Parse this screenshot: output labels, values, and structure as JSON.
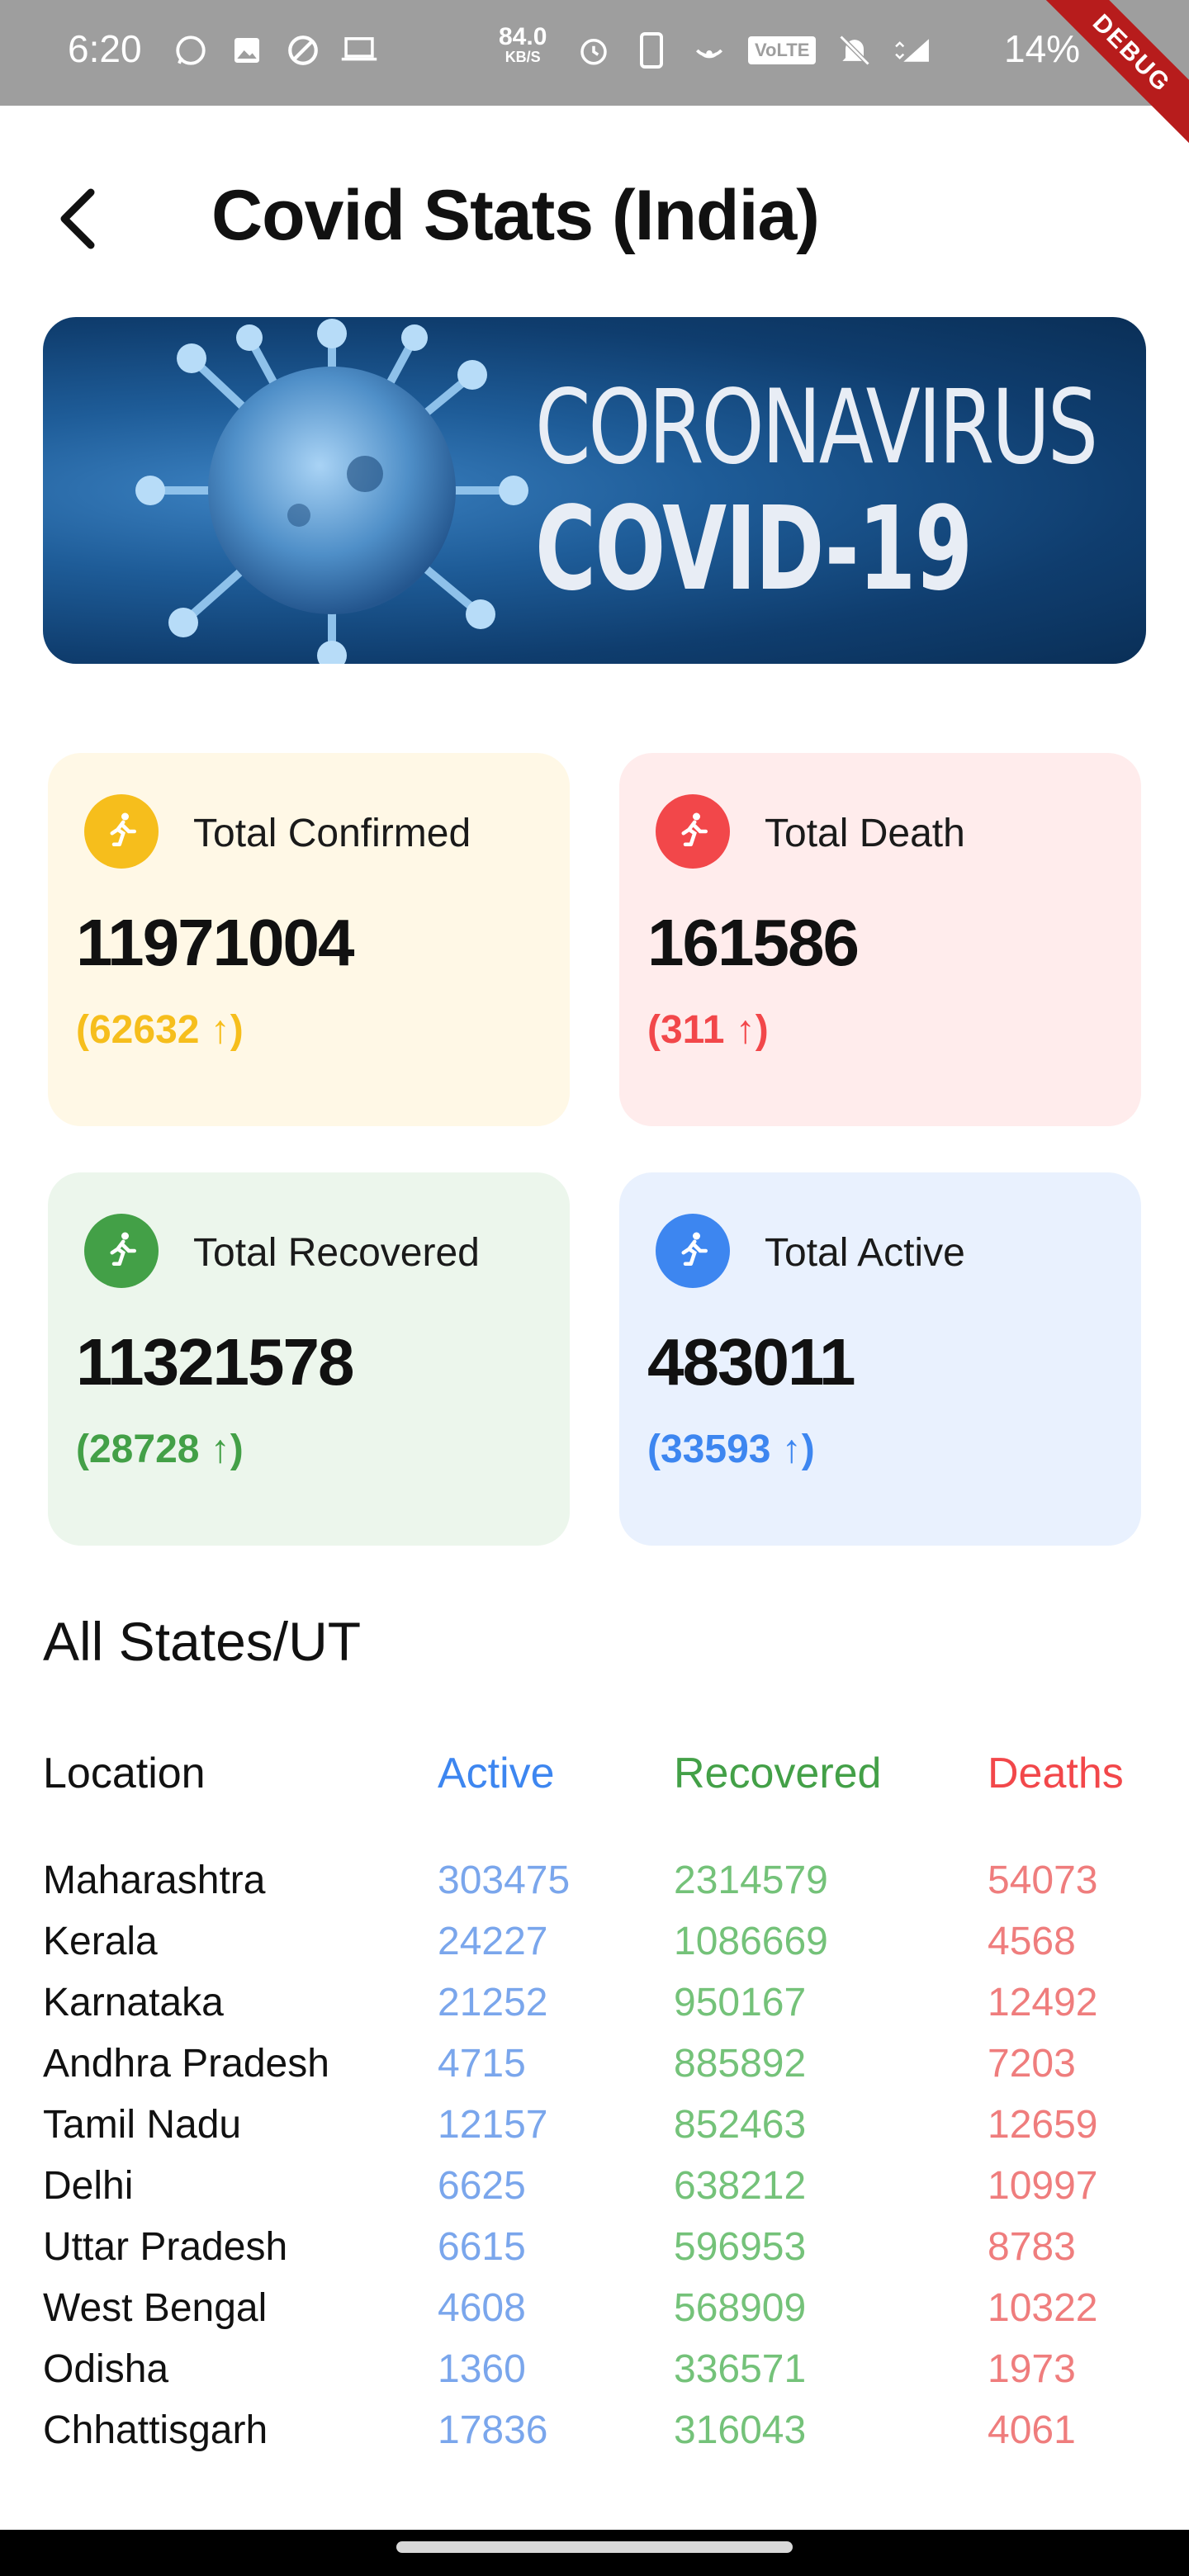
{
  "status_bar": {
    "time": "6:20",
    "speed_value": "84.0",
    "speed_unit": "KB/S",
    "volte": "VoLTE",
    "battery": "14%",
    "debug_label": "DEBUG"
  },
  "header": {
    "title": "Covid Stats (India)"
  },
  "banner": {
    "line1": "CORONAVIRUS",
    "line2": "COVID-19"
  },
  "cards": [
    {
      "label": "Total Confirmed",
      "value": "11971004",
      "delta": "(62632 ↑)",
      "accent": "#f6be1c",
      "bg": "#fff8e6"
    },
    {
      "label": "Total Death",
      "value": "161586",
      "delta": "(311 ↑)",
      "accent": "#f2474a",
      "bg": "#ffecec"
    },
    {
      "label": "Total Recovered",
      "value": "11321578",
      "delta": "(28728 ↑)",
      "accent": "#43a047",
      "bg": "#ecf6ec"
    },
    {
      "label": "Total Active",
      "value": "483011",
      "delta": "(33593 ↑)",
      "accent": "#3d86f0",
      "bg": "#e9f1fe"
    }
  ],
  "states": {
    "title": "All States/UT",
    "columns": {
      "location": "Location",
      "active": "Active",
      "recovered": "Recovered",
      "deaths": "Deaths"
    },
    "rows": [
      {
        "location": "Maharashtra",
        "active": "303475",
        "recovered": "2314579",
        "deaths": "54073"
      },
      {
        "location": "Kerala",
        "active": "24227",
        "recovered": "1086669",
        "deaths": "4568"
      },
      {
        "location": "Karnataka",
        "active": "21252",
        "recovered": "950167",
        "deaths": "12492"
      },
      {
        "location": "Andhra Pradesh",
        "active": "4715",
        "recovered": "885892",
        "deaths": "7203"
      },
      {
        "location": "Tamil Nadu",
        "active": "12157",
        "recovered": "852463",
        "deaths": "12659"
      },
      {
        "location": "Delhi",
        "active": "6625",
        "recovered": "638212",
        "deaths": "10997"
      },
      {
        "location": "Uttar Pradesh",
        "active": "6615",
        "recovered": "596953",
        "deaths": "8783"
      },
      {
        "location": "West Bengal",
        "active": "4608",
        "recovered": "568909",
        "deaths": "10322"
      },
      {
        "location": "Odisha",
        "active": "1360",
        "recovered": "336571",
        "deaths": "1973"
      },
      {
        "location": "Chhattisgarh",
        "active": "17836",
        "recovered": "316043",
        "deaths": "4061"
      }
    ]
  },
  "colors": {
    "active": "#3d86f0",
    "recovered": "#43a047",
    "deaths": "#f2474a"
  }
}
